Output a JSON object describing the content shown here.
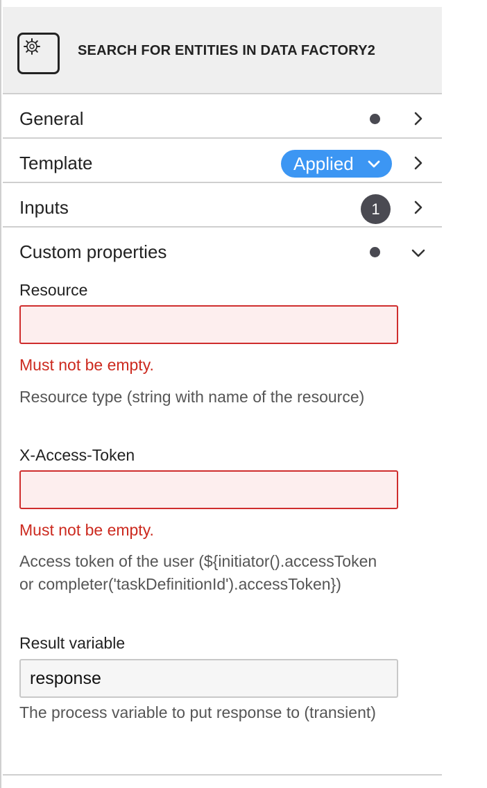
{
  "header": {
    "icon": "gear-icon",
    "title": "SEARCH FOR ENTITIES IN DATA FACTORY2"
  },
  "groups": [
    {
      "label": "General",
      "indicator": "dot",
      "expanded": false
    },
    {
      "label": "Template",
      "badge": "Applied",
      "expanded": false
    },
    {
      "label": "Inputs",
      "count": "1",
      "expanded": false
    },
    {
      "label": "Custom properties",
      "indicator": "dot",
      "expanded": true
    }
  ],
  "custom_properties": {
    "resource": {
      "label": "Resource",
      "value": "",
      "error": "Must not be empty.",
      "description": "Resource type (string with name of the resource)"
    },
    "access_token": {
      "label": "X-Access-Token",
      "value": "",
      "error": "Must not be empty.",
      "description": "Access token of the user (${initiator().accessToken or completer('taskDefinitionId').accessToken})"
    },
    "result_variable": {
      "label": "Result variable",
      "value": "response",
      "description": "The process variable to put response to (transient)"
    }
  },
  "colors": {
    "accent": "#3c96f3",
    "error": "#cc2a1f",
    "badge_dark": "#4a4a52",
    "header_bg": "#efefef"
  }
}
